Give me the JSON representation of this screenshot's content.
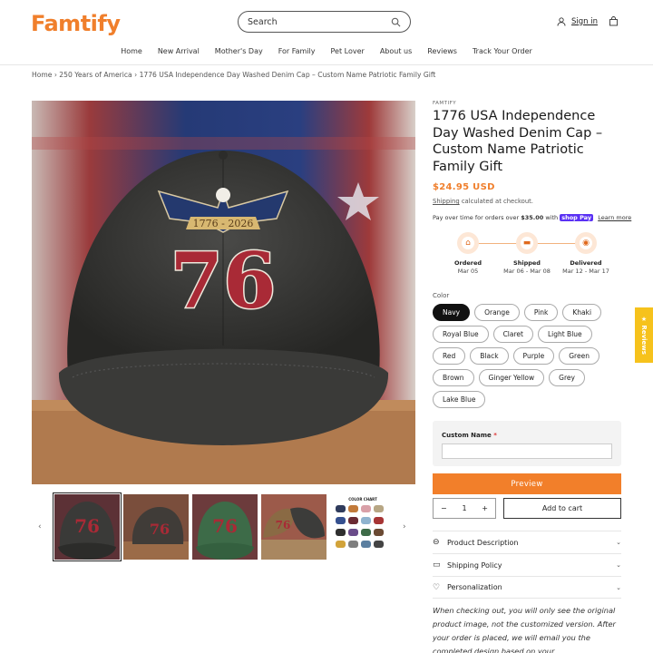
{
  "brand": {
    "logo": "Famtify",
    "accent": "#f07f2c"
  },
  "header": {
    "search_placeholder": "Search",
    "signin": "Sign in"
  },
  "nav": [
    "Home",
    "New Arrival",
    "Mother's Day",
    "For Family",
    "Pet Lover",
    "About us",
    "Reviews",
    "Track Your Order"
  ],
  "breadcrumb": "Home › 250 Years of America › 1776 USA Independence Day Washed Denim Cap – Custom Name Patriotic Family Gift",
  "product": {
    "vendor": "FAMTIFY",
    "title": "1776 USA Independence Day Washed Denim Cap – Custom Name Patriotic Family Gift",
    "price": "$24.95 USD",
    "shipping_link": "Shipping",
    "shipping_rest": " calculated at checkout.",
    "pay_over": "Pay over time for orders over ",
    "pay_amount": "$35.00",
    "pay_with": " with ",
    "shoppay": "shop Pay",
    "learn_more": "Learn more",
    "cap_year": "1776 - 2026",
    "cap_number": "76"
  },
  "timeline": [
    {
      "label": "Ordered",
      "date": "Mar 05",
      "icon": "shop-icon"
    },
    {
      "label": "Shipped",
      "date": "Mar 06 - Mar 08",
      "icon": "truck-icon"
    },
    {
      "label": "Delivered",
      "date": "Mar 12 - Mar 17",
      "icon": "location-pin-icon"
    }
  ],
  "color_label": "Color",
  "colors": [
    "Navy",
    "Orange",
    "Pink",
    "Khaki",
    "Royal Blue",
    "Claret",
    "Light Blue",
    "Red",
    "Black",
    "Purple",
    "Green",
    "Brown",
    "Ginger Yellow",
    "Grey",
    "Lake Blue"
  ],
  "selected_color": "Navy",
  "custom": {
    "label": "Custom Name",
    "required": "*"
  },
  "preview_label": "Preview",
  "quantity": {
    "minus": "−",
    "value": "1",
    "plus": "+"
  },
  "add_to_cart": "Add to cart",
  "accordions": [
    {
      "label": "Product Description",
      "icon": "chat-icon"
    },
    {
      "label": "Shipping Policy",
      "icon": "truck-icon"
    },
    {
      "label": "Personalization",
      "icon": "heart-icon"
    }
  ],
  "note": "When checking out, you will only see the original product image, not the customized version. After your order is placed, we will email you the completed design based on your",
  "thumb_chart_label": "COLOR CHART",
  "reviews_tab": "★ Reviews"
}
